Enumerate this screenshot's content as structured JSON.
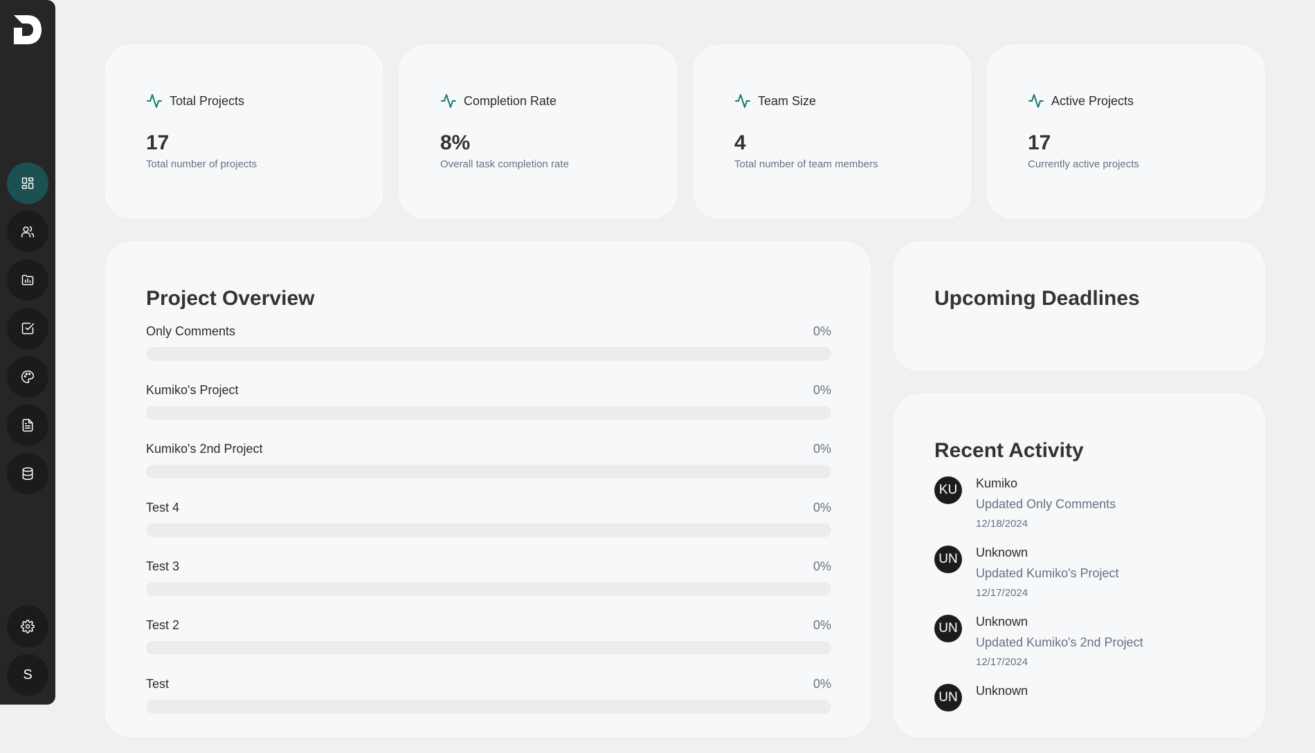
{
  "sidebar": {
    "logo_letter": "D",
    "user_initial": "S",
    "items": [
      {
        "icon": "dashboard-icon",
        "active": true
      },
      {
        "icon": "users-icon",
        "active": false
      },
      {
        "icon": "projects-folder-icon",
        "active": false
      },
      {
        "icon": "tasks-checkbox-icon",
        "active": false
      },
      {
        "icon": "palette-icon",
        "active": false
      },
      {
        "icon": "document-icon",
        "active": false
      },
      {
        "icon": "database-icon",
        "active": false
      }
    ],
    "settings_icon": "gear-icon"
  },
  "stats": [
    {
      "title": "Total Projects",
      "value": "17",
      "desc": "Total number of projects"
    },
    {
      "title": "Completion Rate",
      "value": "8%",
      "desc": "Overall task completion rate"
    },
    {
      "title": "Team Size",
      "value": "4",
      "desc": "Total number of team members"
    },
    {
      "title": "Active Projects",
      "value": "17",
      "desc": "Currently active projects"
    }
  ],
  "overview": {
    "title": "Project Overview",
    "projects": [
      {
        "name": "Only Comments",
        "percent_label": "0%",
        "progress": 0
      },
      {
        "name": "Kumiko's Project",
        "percent_label": "0%",
        "progress": 0
      },
      {
        "name": "Kumiko's 2nd Project",
        "percent_label": "0%",
        "progress": 0
      },
      {
        "name": "Test 4",
        "percent_label": "0%",
        "progress": 0
      },
      {
        "name": "Test 3",
        "percent_label": "0%",
        "progress": 0
      },
      {
        "name": "Test 2",
        "percent_label": "0%",
        "progress": 0
      },
      {
        "name": "Test",
        "percent_label": "0%",
        "progress": 0
      }
    ]
  },
  "deadlines": {
    "title": "Upcoming Deadlines"
  },
  "activity": {
    "title": "Recent Activity",
    "items": [
      {
        "initials": "KU",
        "user": "Kumiko",
        "text": "Updated Only Comments",
        "date": "12/18/2024"
      },
      {
        "initials": "UN",
        "user": "Unknown",
        "text": "Updated Kumiko's Project",
        "date": "12/17/2024"
      },
      {
        "initials": "UN",
        "user": "Unknown",
        "text": "Updated Kumiko's 2nd Project",
        "date": "12/17/2024"
      },
      {
        "initials": "UN",
        "user": "Unknown",
        "text": "",
        "date": ""
      }
    ]
  },
  "colors": {
    "accent": "#147a76",
    "sidebar": "#262626",
    "active_nav": "#1d5052"
  }
}
